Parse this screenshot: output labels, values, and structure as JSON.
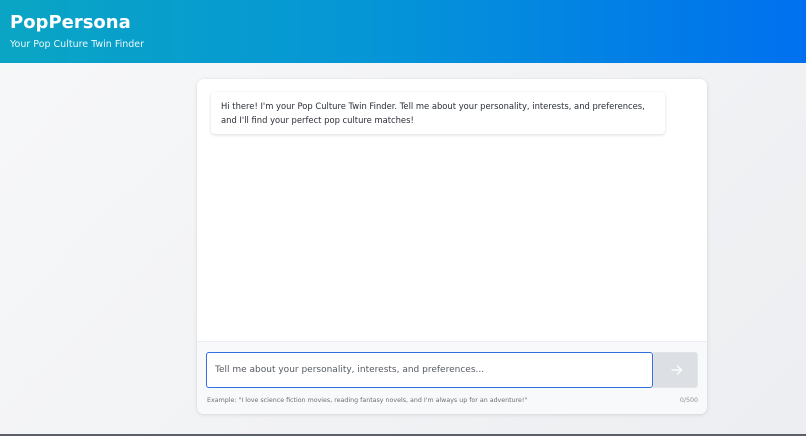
{
  "header": {
    "title": "PopPersona",
    "subtitle": "Your Pop Culture Twin Finder"
  },
  "chat": {
    "messages": [
      {
        "sender": "bot",
        "text": "Hi there! I'm your Pop Culture Twin Finder. Tell me about your personality, interests, and preferences, and I'll find your perfect pop culture matches!"
      }
    ],
    "input": {
      "value": "",
      "placeholder": "Tell me about your personality, interests, and preferences..."
    },
    "send_button_icon": "arrow-right-icon",
    "hint": "Example: \"I love science fiction movies, reading fantasy novels, and I'm always up for an adventure!\"",
    "char_count": "0/500"
  },
  "colors": {
    "header_gradient_start": "#0aa5c4",
    "header_gradient_end": "#0070f0",
    "input_focus_border": "#2f6fe0",
    "send_button_bg": "#dcdfe3"
  }
}
